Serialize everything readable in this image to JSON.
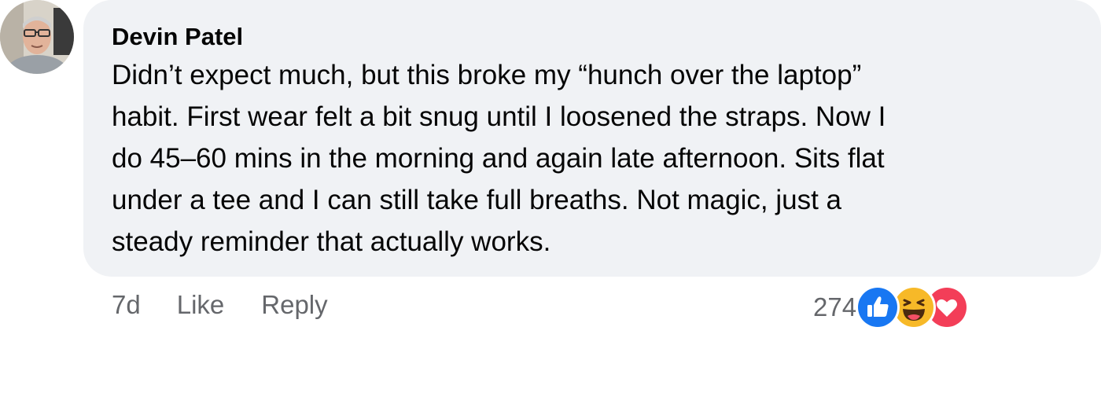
{
  "comment": {
    "author": "Devin Patel",
    "text_lines": [
      "Didn’t expect much, but this broke my “hunch over the laptop”",
      "habit. First wear felt a bit snug until I loosened the straps. Now I",
      "do 45–60 mins in the morning and again late afternoon. Sits flat",
      "under a tee and I can still take full breaths. Not magic, just a",
      "steady reminder that actually works."
    ],
    "timestamp": "7d",
    "like_label": "Like",
    "reply_label": "Reply",
    "reaction_count": "274",
    "reactions": [
      "like-icon",
      "haha-icon",
      "love-icon"
    ]
  },
  "colors": {
    "bubble": "#f0f2f5",
    "meta_text": "#65676b",
    "like_blue": "#1877f2",
    "haha_yellow": "#f7b928",
    "love_red": "#f33e58"
  }
}
